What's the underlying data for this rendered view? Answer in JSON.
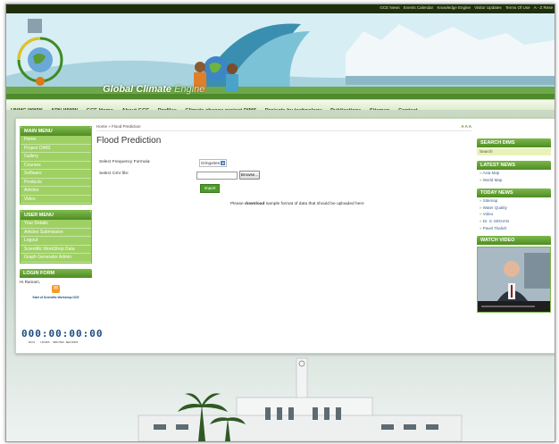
{
  "top_links": [
    "GCE News",
    "Events Calendar",
    "Knowledge Engine",
    "Visitor Updates",
    "Terms Of Use",
    "A - Z Rese"
  ],
  "brand": {
    "title": "Global Climate",
    "suffix": "Engine"
  },
  "nav": [
    "UNMC WWW",
    "APN WWW",
    "GCE Home",
    "About GCE",
    "Profiles",
    "Climate change project DIMS",
    "Projects by technology",
    "Publications",
    "Sitemap",
    "Contact"
  ],
  "breadcrumb": "Home » Flood Prediction",
  "font_size_controls": "A A A",
  "page_title": "Flood Prediction",
  "form": {
    "frequency_label": "Select Frequency Formula:",
    "frequency_value": "Gringorten",
    "csv_label": "Select CSV file:",
    "browse_label": "Browse...",
    "import_label": "Import",
    "note_prefix": "Please",
    "note_link": "download",
    "note_suffix": "sample format of data that should be uploaded here"
  },
  "main_menu": {
    "title": "MAIN MENU",
    "items": [
      "Home",
      "Project DIMS",
      "Gallery",
      "Courses",
      "Software",
      "Products",
      "Articles",
      "Video"
    ]
  },
  "user_menu": {
    "title": "USER MENU",
    "items": [
      "Your Details",
      "Articles Submission",
      "Logout",
      "Scientific WorkShop Data",
      "Graph Generator Admin"
    ]
  },
  "login_form": {
    "title": "LOGIN FORM",
    "greeting": "Hi Ramam,",
    "workshop_caption": "Start of Scientific Workshop GCE",
    "countdown": "000:00:00:00",
    "countdown_labels": [
      "DAYS",
      "HOURS",
      "MINUTES",
      "SECONDS"
    ]
  },
  "right": {
    "search_title": "SEARCH DIMS",
    "search_placeholder": "Search",
    "latest_news_title": "LATEST NEWS",
    "latest_news": [
      "Asia Map",
      "World Map"
    ],
    "today_news_title": "TODAY NEWS",
    "today_news": [
      "Sitemap",
      "Water Quality",
      "Video",
      "Dr. S. MOHAN",
      "Pavel Tkalich"
    ],
    "watch_video_title": "WATCH VIDEO"
  },
  "colors": {
    "accent_green": "#7cb84a",
    "dark_green": "#1f2f0e",
    "link_blue": "#3c5e8a"
  }
}
